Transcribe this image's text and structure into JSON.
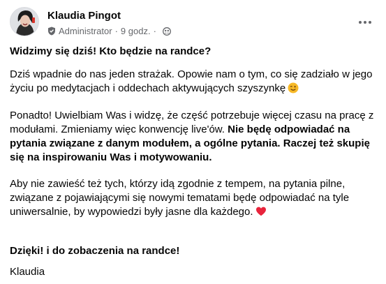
{
  "author": {
    "name": "Klaudia Pingot",
    "role": "Administrator",
    "time": "9 godz."
  },
  "post": {
    "title": "Widzimy się dziś! Kto będzie na randce?",
    "p1": "Dziś wpadnie do nas jeden strażak. Opowie nam o tym, co się zadziało w jego życiu po medytacjach i oddechach aktywujących szyszynkę",
    "p2_normal": "Ponadto! Uwielbiam Was i widzę, że część potrzebuje więcej czasu na pracę z modułami. Zmieniamy więc konwencję live'ów. ",
    "p2_bold": "Nie będę odpowiadać na pytania związane z danym modułem, a ogólne pytania. Raczej też skupię się na inspirowaniu Was i motywowaniu.",
    "p3": "Aby nie zawieść też tych, którzy idą zgodnie z tempem, na pytania pilne, związane z pojawiającymi się nowymi tematami będę odpowiadać na tyle uniwersalnie, by wypowiedzi były jasne dla każdego.",
    "p4": "Dzięki! i do zobaczenia na randce!",
    "p5": "Klaudia"
  },
  "icons": {
    "wink": "winking-face-emoji",
    "heart": "red-heart-emoji",
    "shield": "admin-shield-icon",
    "globe": "audience-group-icon",
    "more": "more-options-icon"
  },
  "colors": {
    "text": "#050505",
    "meta": "#65676b",
    "heart": "#e8243c",
    "emoji_yellow": "#f7b928"
  }
}
